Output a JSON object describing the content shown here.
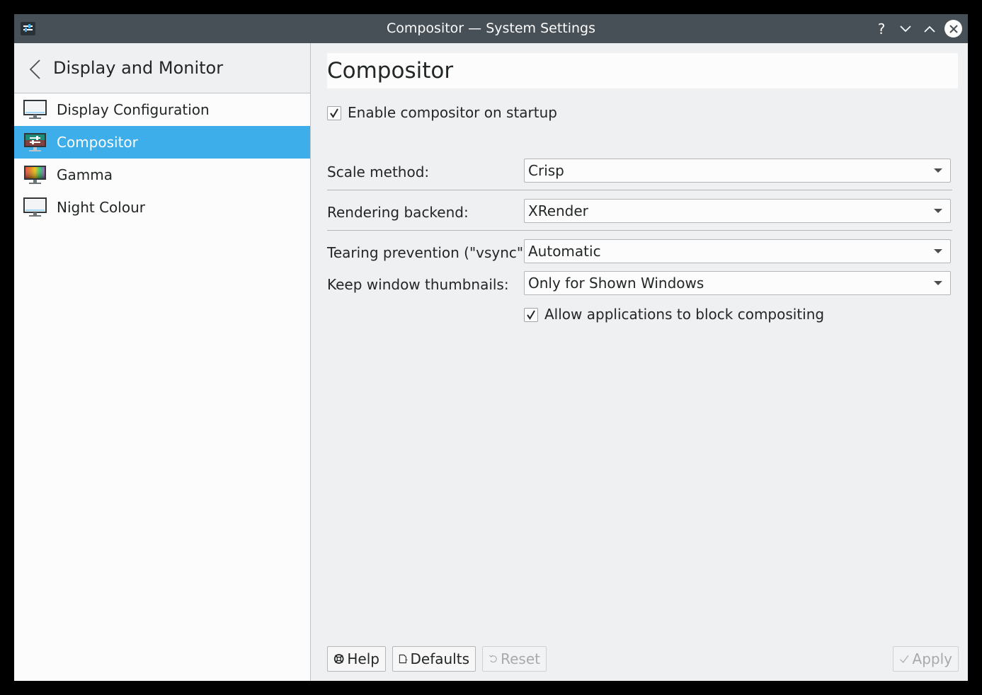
{
  "window": {
    "title": "Compositor — System Settings",
    "buttons": {
      "help": "?",
      "minimize": "⌄",
      "maximize": "⌃",
      "close": "✕"
    }
  },
  "sidebar": {
    "title": "Display and Monitor",
    "items": [
      {
        "label": "Display Configuration",
        "icon": "monitor-icon",
        "selected": false
      },
      {
        "label": "Compositor",
        "icon": "compositor-icon",
        "selected": true
      },
      {
        "label": "Gamma",
        "icon": "gamma-icon",
        "selected": false
      },
      {
        "label": "Night Colour",
        "icon": "night-colour-icon",
        "selected": false
      }
    ]
  },
  "main": {
    "title": "Compositor",
    "enable_compositor": {
      "label": "Enable compositor on startup",
      "checked": true
    },
    "scale_method": {
      "label": "Scale method:",
      "value": "Crisp"
    },
    "rendering_backend": {
      "label": "Rendering backend:",
      "value": "XRender"
    },
    "tearing_prevention": {
      "label": "Tearing prevention (\"vsync\"):",
      "value": "Automatic"
    },
    "keep_thumbnails": {
      "label": "Keep window thumbnails:",
      "value": "Only for Shown Windows"
    },
    "allow_block": {
      "label": "Allow applications to block compositing",
      "checked": true
    }
  },
  "footer": {
    "help": "Help",
    "defaults": "Defaults",
    "reset": "Reset",
    "apply": "Apply"
  },
  "colors": {
    "accent": "#3daee9",
    "titlebar": "#475057",
    "window_bg": "#eff0f1",
    "view_bg": "#fcfcfc"
  }
}
